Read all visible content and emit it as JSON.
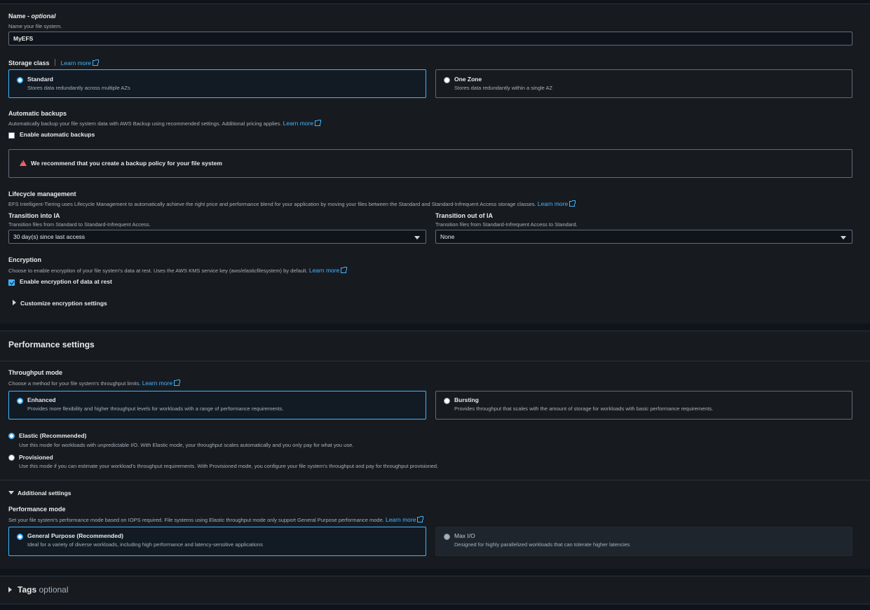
{
  "name_field": {
    "label": "Name",
    "optional": "optional",
    "sep": " - ",
    "description": "Name your file system.",
    "value": "MyEFS"
  },
  "storage_class": {
    "label": "Storage class",
    "learn_more": "Learn more",
    "options": [
      {
        "label": "Standard",
        "desc": "Stores data redundantly across multiple AZs",
        "selected": true
      },
      {
        "label": "One Zone",
        "desc": "Stores data redundantly within a single AZ",
        "selected": false
      }
    ]
  },
  "backups": {
    "label": "Automatic backups",
    "description": "Automatically backup your file system data with AWS Backup using recommended settings. Additional pricing applies.",
    "learn_more": "Learn more",
    "checkbox": "Enable automatic backups",
    "checked": false,
    "warning": "We recommend that you create a backup policy for your file system"
  },
  "lifecycle": {
    "label": "Lifecycle management",
    "description": "EFS Intelligent-Tiering uses Lifecycle Management to automatically achieve the right price and performance blend for your application by moving your files between the Standard and Standard-Infrequent Access storage classes.",
    "learn_more": "Learn more",
    "into_ia": {
      "label": "Transition into IA",
      "desc": "Transition files from Standard to Standard-Infrequent Access.",
      "value": "30 day(s) since last access"
    },
    "out_ia": {
      "label": "Transition out of IA",
      "desc": "Transition files from Standard-Infrequent Access to Standard.",
      "value": "None"
    }
  },
  "encryption": {
    "label": "Encryption",
    "description": "Choose to enable encryption of your file system's data at rest. Uses the AWS KMS service key (aws/elasticfilesystem) by default.",
    "learn_more": "Learn more",
    "checkbox": "Enable encryption of data at rest",
    "checked": true,
    "customize": "Customize encryption settings"
  },
  "performance": {
    "heading": "Performance settings",
    "throughput_label": "Throughput mode",
    "throughput_desc": "Choose a method for your file system's throughput limits.",
    "learn_more": "Learn more",
    "tiles": [
      {
        "label": "Enhanced",
        "desc": "Provides more flexibility and higher throughput levels for workloads with a range of performance requirements.",
        "selected": true
      },
      {
        "label": "Bursting",
        "desc": "Provides throughput that scales with the amount of storage for workloads with basic performance requirements.",
        "selected": false
      }
    ],
    "sub_options": [
      {
        "label": "Elastic (Recommended)",
        "desc": "Use this mode for workloads with unpredictable I/O. With Elastic mode, your throughput scales automatically and you only pay for what you use.",
        "selected": true
      },
      {
        "label": "Provisioned",
        "desc": "Use this mode if you can estimate your workload's throughput requirements. With Provisioned mode, you configure your file system's throughput and pay for throughput provisioned.",
        "selected": false
      }
    ],
    "additional": "Additional settings",
    "perf_mode_label": "Performance mode",
    "perf_mode_desc": "Set your file system's performance mode based on IOPS required. File systems using Elastic throughput mode only support General Purpose performance mode.",
    "perf_tiles": [
      {
        "label": "General Purpose (Recommended)",
        "desc": "Ideal for a variety of diverse workloads, including high performance and latency-sensitive applications",
        "selected": true
      },
      {
        "label": "Max I/O",
        "desc": "Designed for highly parallelized workloads that can tolerate higher latencies",
        "selected": false,
        "disabled": true
      }
    ]
  },
  "tags": {
    "label": "Tags",
    "optional": "optional"
  }
}
